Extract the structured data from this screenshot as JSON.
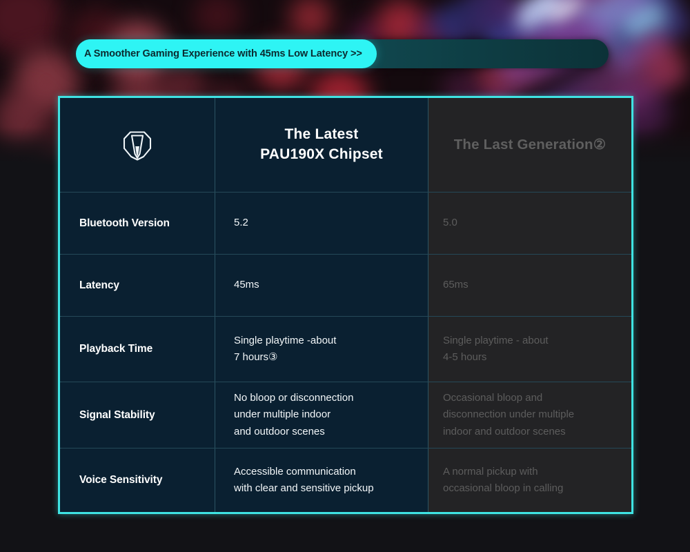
{
  "banner": {
    "text": "A Smoother Gaming Experience with 45ms Low Latency >>",
    "pill_color": "#2ef4f4",
    "shell_color": "#10474e",
    "text_color": "#0b2b30"
  },
  "table": {
    "border_color": "#3fe3e3",
    "new_column_bg": "#0a2031",
    "old_column_bg": "#232325",
    "header": {
      "logo_icon": "brand-shield-icon",
      "new_title_line1": "The Latest",
      "new_title_line2": "PAU190X Chipset",
      "old_title": "The Last Generation②"
    },
    "rows": [
      {
        "label": "Bluetooth Version",
        "new": [
          "5.2"
        ],
        "old": [
          "5.0"
        ]
      },
      {
        "label": "Latency",
        "new": [
          "45ms"
        ],
        "old": [
          "65ms"
        ]
      },
      {
        "label": "Playback Time",
        "new": [
          "Single playtime -about",
          "7 hours③"
        ],
        "old": [
          "Single playtime - about",
          "4-5 hours"
        ]
      },
      {
        "label": "Signal Stability",
        "new": [
          "No bloop or disconnection",
          "under multiple indoor",
          "and outdoor scenes"
        ],
        "old": [
          "Occasional bloop and",
          "disconnection under multiple",
          "indoor and outdoor scenes"
        ]
      },
      {
        "label": "Voice Sensitivity",
        "new": [
          "Accessible communication",
          "with clear and sensitive pickup"
        ],
        "old": [
          "A normal pickup with",
          "occasional bloop in calling"
        ]
      }
    ]
  }
}
